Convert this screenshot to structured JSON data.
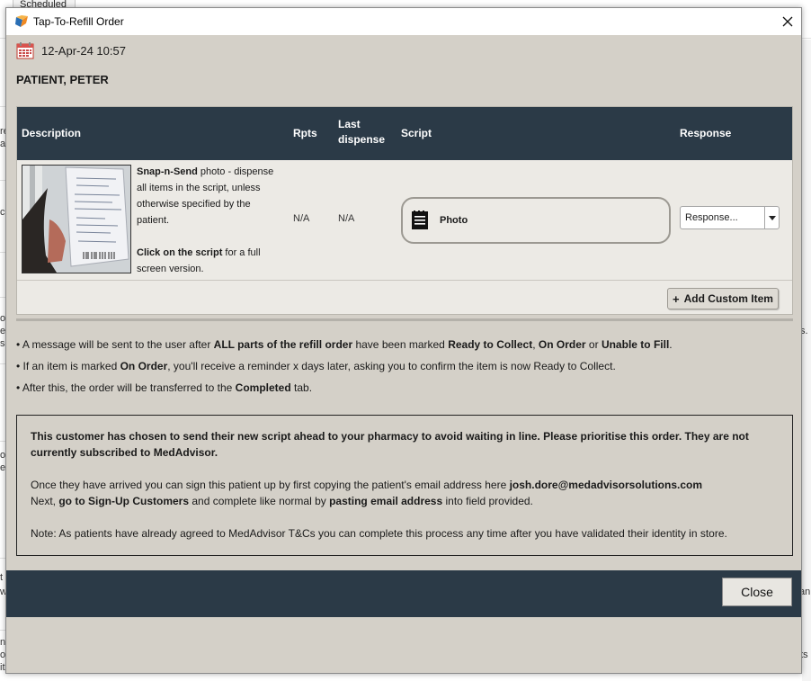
{
  "background": {
    "tab_label": "Scheduled",
    "fragments_left": [
      "re",
      "av",
      "c",
      "o",
      "ec",
      "se",
      "oc",
      "e",
      "t",
      "w",
      "na",
      "oc",
      "it"
    ],
    "fragments_right": [
      "s.",
      "an",
      "nts"
    ]
  },
  "window": {
    "title": "Tap-To-Refill Order",
    "close_glyph": "✕",
    "app_icon": "app-logo-icon"
  },
  "order": {
    "datetime": "12-Apr-24 10:57",
    "calendar_icon": "calendar-icon",
    "patient_name": "PATIENT, PETER"
  },
  "table": {
    "headers": {
      "description": "Description",
      "rpts": "Rpts",
      "last_dispense": "Last dispense",
      "script": "Script",
      "response": "Response"
    },
    "row": {
      "desc_bold_1": "Snap-n-Send",
      "desc_text_1": " photo - dispense all items in the script, unless otherwise specified by the patient.",
      "desc_bold_2": "Click on the script",
      "desc_text_2": " for a full screen version.",
      "rpts": "N/A",
      "last_dispense": "N/A",
      "script_label": "Photo",
      "response_value": "Response..."
    },
    "add_custom_label": "Add Custom Item"
  },
  "bullets": [
    [
      {
        "t": "• A message will be sent to the user after ",
        "b": false
      },
      {
        "t": "ALL parts of the refill order",
        "b": true
      },
      {
        "t": " have been marked ",
        "b": false
      },
      {
        "t": "Ready to Collect",
        "b": true
      },
      {
        "t": ", ",
        "b": false
      },
      {
        "t": "On Order",
        "b": true
      },
      {
        "t": " or ",
        "b": false
      },
      {
        "t": "Unable to Fill",
        "b": true
      },
      {
        "t": ".",
        "b": false
      }
    ],
    [
      {
        "t": "• If an item is marked ",
        "b": false
      },
      {
        "t": "On Order",
        "b": true
      },
      {
        "t": ", you'll receive a reminder x days later, asking you to confirm the item is now Ready to Collect.",
        "b": false
      }
    ],
    [
      {
        "t": "• After this, the order will be transferred to the ",
        "b": false
      },
      {
        "t": "Completed",
        "b": true
      },
      {
        "t": " tab.",
        "b": false
      }
    ]
  ],
  "notice": {
    "headline": "This customer has chosen to send their new script ahead to your pharmacy to avoid waiting in line. Please prioritise this order. They are not currently subscribed to MedAdvisor.",
    "line1_text": "Once they have arrived you can sign this patient up by first copying the patient's email address here ",
    "line1_email": "josh.dore@medadvisorsolutions.com",
    "line2_a": "Next, ",
    "line2_bold1": "go to Sign-Up Customers",
    "line2_b": " and complete like normal by ",
    "line2_bold2": "pasting email address",
    "line2_c": " into field provided.",
    "note": "Note: As patients have already agreed to MedAdvisor T&Cs you can complete this process any time after you have validated their identity in store."
  },
  "footer": {
    "close_label": "Close"
  },
  "colors": {
    "header_bg": "#2b3a47",
    "dialog_bg": "#d4d0c8",
    "row_bg": "#eceae5"
  }
}
